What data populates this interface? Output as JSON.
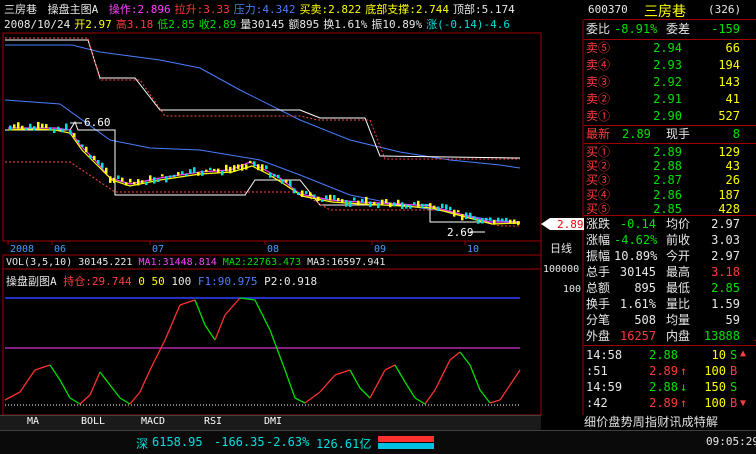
{
  "header": {
    "title": "三房巷",
    "indicator": "操盘主图A",
    "items": [
      {
        "label": "操作:2.896",
        "color": "#ff40ff"
      },
      {
        "label": "拉升:3.33",
        "color": "#ff3b3b"
      },
      {
        "label": "压力:4.342",
        "color": "#4a7dff"
      },
      {
        "label": "买卖:2.822",
        "color": "#ffff00"
      },
      {
        "label": "底部支撑:2.744",
        "color": "#ffff00"
      },
      {
        "label": "顶部:5.174",
        "color": "#e8e8e8"
      }
    ],
    "date": "2008/10/24",
    "open": "开2.97",
    "high": "高3.18",
    "low": "低2.85",
    "close": "收2.89",
    "volume": "量30145",
    "amount": "额895",
    "turnover": "换1.61%",
    "amplitude": "振10.89%",
    "change": "涨(-0.14)-4.6"
  },
  "main_chart": {
    "label_high": "6.60",
    "label_low": "2.69",
    "price_marker": "2.89",
    "months": [
      "2008",
      "06",
      "07",
      "08",
      "09",
      "10"
    ],
    "period_label": "日线",
    "y_scale_top": "100000",
    "y_scale_mid": "100"
  },
  "volume_bar": {
    "label": "VOL(3,5,10)",
    "vol": "30145.221",
    "ma1": "MA1:31448.814",
    "ma2": "MA2:22763.473",
    "ma3": "MA3:16597.941"
  },
  "sub_chart": {
    "title": "操盘副图A",
    "hold": "持仓:29.744",
    "v0": "0",
    "v50": "50",
    "v100": "100",
    "f1": "F1:90.975",
    "p2": "P2:0.918"
  },
  "tabs": [
    "MA",
    "BOLL",
    "MACD",
    "RSI",
    "DMI"
  ],
  "quote": {
    "code": "600370",
    "name": "三房巷",
    "rank": "(326)",
    "webi_label": "委比",
    "webi": "-8.91%",
    "weicha_label": "委差",
    "weicha": "-159",
    "sells": [
      {
        "label": "卖⑤",
        "price": "2.94",
        "vol": "66"
      },
      {
        "label": "卖④",
        "price": "2.93",
        "vol": "194"
      },
      {
        "label": "卖③",
        "price": "2.92",
        "vol": "143"
      },
      {
        "label": "卖②",
        "price": "2.91",
        "vol": "41"
      },
      {
        "label": "卖①",
        "price": "2.90",
        "vol": "527"
      }
    ],
    "latest_label": "最新",
    "latest": "2.89",
    "now_label": "现手",
    "now": "8",
    "buys": [
      {
        "label": "买①",
        "price": "2.89",
        "vol": "129"
      },
      {
        "label": "买②",
        "price": "2.88",
        "vol": "43"
      },
      {
        "label": "买③",
        "price": "2.87",
        "vol": "26"
      },
      {
        "label": "买④",
        "price": "2.86",
        "vol": "187"
      },
      {
        "label": "买⑤",
        "price": "2.85",
        "vol": "428"
      }
    ],
    "stats": [
      {
        "l1": "涨跌",
        "v1": "-0.14",
        "l2": "均价",
        "v2": "2.97"
      },
      {
        "l1": "涨幅",
        "v1": "-4.62%",
        "l2": "前收",
        "v2": "3.03"
      },
      {
        "l1": "振幅",
        "v1": "10.89%",
        "l2": "今开",
        "v2": "2.97"
      },
      {
        "l1": "总手",
        "v1": "30145",
        "l2": "最高",
        "v2": "3.18"
      },
      {
        "l1": "总额",
        "v1": "895",
        "l2": "最低",
        "v2": "2.85"
      },
      {
        "l1": "换手",
        "v1": "1.61%",
        "l2": "量比",
        "v2": "1.59"
      },
      {
        "l1": "分笔",
        "v1": "508",
        "l2": "均量",
        "v2": "59"
      }
    ],
    "outer_label": "外盘",
    "outer": "16257",
    "inner_label": "内盘",
    "inner": "13888",
    "ticks": [
      {
        "time": "14:58",
        "price": "2.88",
        "arrow": "",
        "vol": "10",
        "dir": "S"
      },
      {
        "time": ":51",
        "price": "2.89",
        "arrow": "↑",
        "vol": "100",
        "dir": "B"
      },
      {
        "time": "14:59",
        "price": "2.88",
        "arrow": "↓",
        "vol": "150",
        "dir": "S"
      },
      {
        "time": ":42",
        "price": "2.89",
        "arrow": "↑",
        "vol": "100",
        "dir": "B"
      }
    ],
    "bottom_tabs": "细价盘势周指财讯成特解"
  },
  "status": {
    "index_name": "深",
    "index_value": "6158.95",
    "index_change": "-166.35",
    "index_pct": "-2.63%",
    "index_amount": "126.61亿",
    "clock": "09:05:29"
  }
}
